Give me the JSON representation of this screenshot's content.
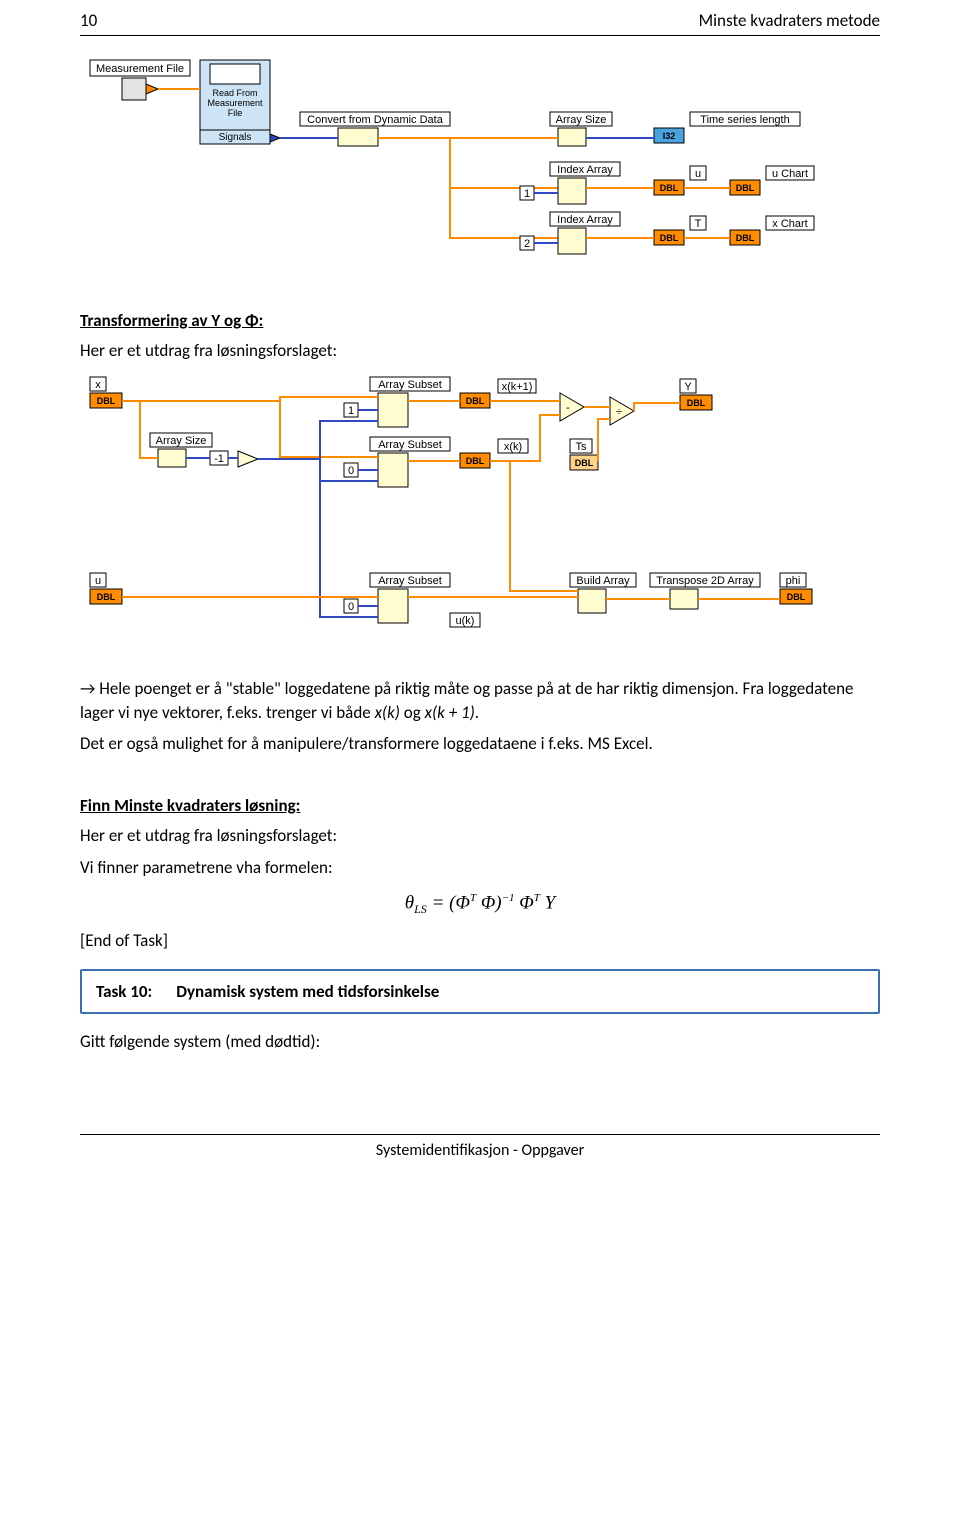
{
  "header": {
    "page": "10",
    "title": "Minste kvadraters metode"
  },
  "diagram1": {
    "measurement_file": "Measurement File",
    "read_from": "Read From\nMeasurement\nFile",
    "signals": "Signals",
    "convert": "Convert from Dynamic Data",
    "array_size": "Array Size",
    "time_series": "Time series length",
    "index_array_1": "Index Array",
    "index_array_2": "Index Array",
    "u": "u",
    "u_chart": "u Chart",
    "t": "T",
    "x_chart": "x Chart",
    "i32": "I32",
    "dbl": "DBL",
    "const1": "1",
    "const2": "2"
  },
  "section1": {
    "title": "Transformering av  Y og Φ:",
    "intro": "Her er et utdrag fra løsningsforslaget:"
  },
  "diagram2": {
    "x": "x",
    "u": "u",
    "array_size": "Array Size",
    "array_subset_1": "Array Subset",
    "array_subset_2": "Array Subset",
    "array_subset_3": "Array Subset",
    "xk1": "x(k+1)",
    "xk": "x(k)",
    "uk": "u(k)",
    "ts": "Ts",
    "y": "Y",
    "build_array": "Build Array",
    "transpose": "Transpose 2D Array",
    "phi": "phi",
    "minus1": "-1",
    "const0_a": "0",
    "const1": "1",
    "const0_b": "0",
    "dbl": "DBL"
  },
  "after": {
    "p1_pre": "→ Hele poenget er å \"stable\" loggedatene på riktig måte og passe på at de har riktig dimensjon. Fra loggedatene lager vi nye vektorer, f.eks. trenger vi både  ",
    "p1_x1": "x(k)",
    "p1_mid": "  og  ",
    "p1_x2": "x(k + 1)",
    "p1_post": ".",
    "p2": "Det er også mulighet for å manipulere/transformere loggedataene i f.eks. MS Excel."
  },
  "section2": {
    "title": "Finn Minste kvadraters løsning:",
    "intro": "Her er et utdrag fra løsningsforslaget:",
    "find": "Vi finner parametrene vha formelen:",
    "formula": "θ_LS = (Φᵀ Φ)⁻¹ Φᵀ Y",
    "end": "[End of Task]"
  },
  "task10": {
    "label": "Task 10:",
    "name": "Dynamisk system med tidsforsinkelse",
    "given": "Gitt følgende system (med dødtid):"
  },
  "footer": "Systemidentifikasjon - Oppgaver"
}
